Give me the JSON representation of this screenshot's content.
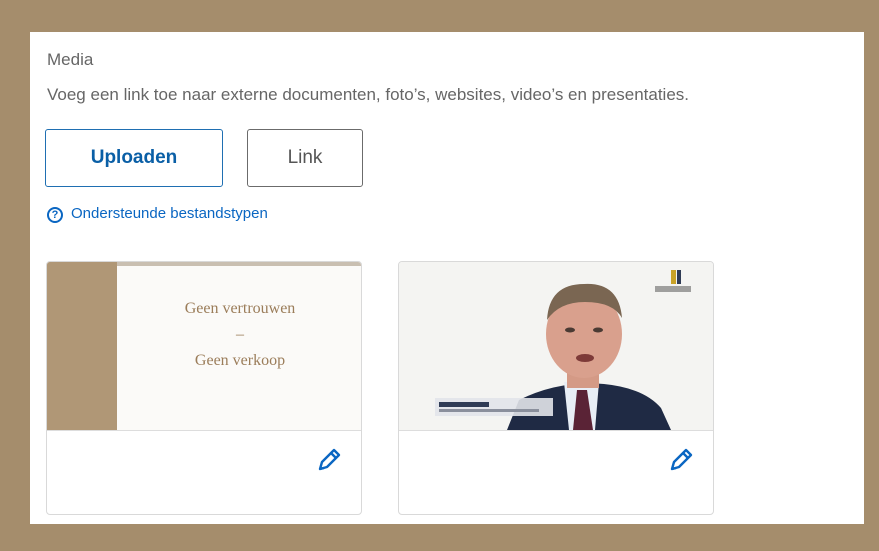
{
  "media": {
    "title": "Media",
    "description": "Voeg een link toe naar externe documenten, foto’s, websites, video’s en presentaties.",
    "upload_label": "Uploaden",
    "link_label": "Link",
    "help_text": "Ondersteunde bestandstypen"
  },
  "cards": [
    {
      "type": "slide",
      "line1": "Geen vertrouwen",
      "line2": "–",
      "line3": "Geen verkoop"
    },
    {
      "type": "video"
    }
  ],
  "colors": {
    "frame": "#a58d6c",
    "accent": "#0a66c2",
    "slide_brown": "#b09776"
  }
}
